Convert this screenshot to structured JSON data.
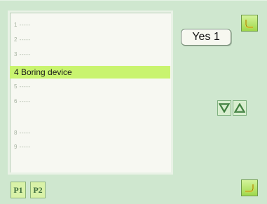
{
  "list": {
    "items": [
      {
        "label": "1 -----"
      },
      {
        "label": "2 -----"
      },
      {
        "label": "3 -----"
      },
      {
        "label": "4 Boring device",
        "selected": true
      },
      {
        "label": "5 -----"
      },
      {
        "label": "6 -----"
      },
      {
        "label": "8 -----"
      },
      {
        "label": "9 -----"
      }
    ]
  },
  "value_box": {
    "text": "Yes 1"
  },
  "pages": {
    "p1": "P1",
    "p2": "P2"
  },
  "icons": {
    "top_right": "curved-arrow-icon",
    "bottom_right": "return-arrow-icon",
    "down": "triangle-down-icon",
    "up": "triangle-up-icon"
  },
  "colors": {
    "background": "#cfe7cf",
    "selection": "#c9f46f",
    "button": "#a6dd55"
  }
}
